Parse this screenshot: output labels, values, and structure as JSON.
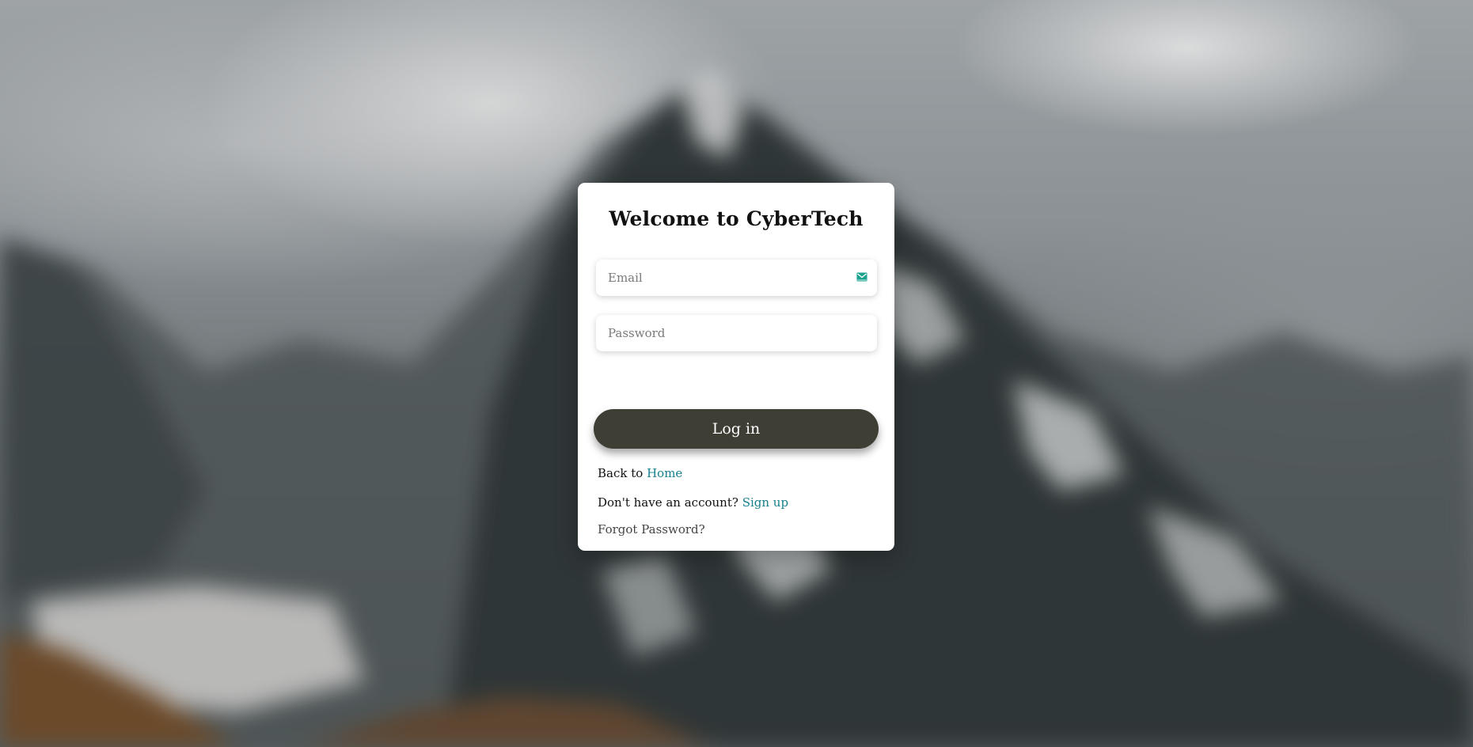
{
  "login": {
    "title": "Welcome to CyberTech",
    "email_placeholder": "Email",
    "password_placeholder": "Password",
    "login_button": "Log in",
    "back_prefix": "Back to",
    "home_link": "Home",
    "signup_prefix": "Don't have an account?",
    "signup_link": "Sign up",
    "forgot_password": "Forgot Password?"
  },
  "icons": {
    "email": "mail-icon"
  },
  "colors": {
    "button": "#3e3e35",
    "link": "#17808c",
    "icon": "#1aa28f"
  }
}
